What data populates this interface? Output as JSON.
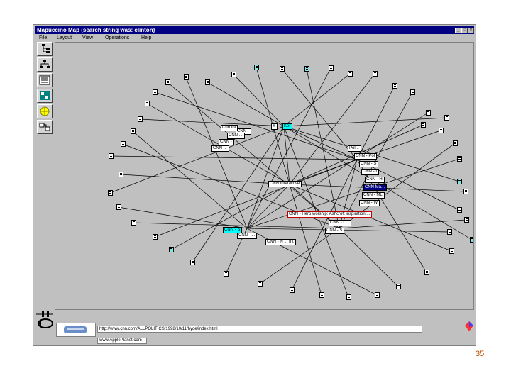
{
  "window": {
    "title": "Mapuccino Map (search string was: clinton)",
    "min": "_",
    "max": "□",
    "close": "×"
  },
  "menu": [
    {
      "label": "File"
    },
    {
      "label": "Layout"
    },
    {
      "label": "View"
    },
    {
      "label": "Operations"
    },
    {
      "label": "Help"
    }
  ],
  "toolbar_icons": [
    "tree-layout-icon",
    "hierarchy-layout-icon",
    "list-layout-icon",
    "map-layout-icon",
    "world-icon",
    "refresh-icon"
  ],
  "graph": {
    "labels": [
      {
        "text": "Y",
        "style": "white"
      },
      {
        "text": "Ker",
        "style": "hl"
      },
      {
        "text": "CNN -",
        "style": "white"
      },
      {
        "text": "CNN ...",
        "style": "white"
      },
      {
        "text": "CNN -",
        "style": "white"
      },
      {
        "text": "CNN ...",
        "style": "white"
      },
      {
        "text": "Cnn Int",
        "style": "white"
      },
      {
        "text": "CNN Interactive",
        "style": "white"
      },
      {
        "text": "Pol...",
        "style": "white"
      },
      {
        "text": "CNN - Pol",
        "style": "white"
      },
      {
        "text": "CNN - S",
        "style": "white"
      },
      {
        "text": "CNN - I",
        "style": "white"
      },
      {
        "text": "CNN - H",
        "style": "white"
      },
      {
        "text": "CNN Ma...",
        "style": "sel"
      },
      {
        "text": "CNN - ML",
        "style": "white"
      },
      {
        "text": "CNN - W",
        "style": "white"
      },
      {
        "text": "CNN - Hero worship: Ashcroft inspiration/...",
        "style": "red"
      },
      {
        "text": "CNN - L...",
        "style": "white"
      },
      {
        "text": "CNN - S",
        "style": "white"
      },
      {
        "text": "CNN - S",
        "style": "hl"
      },
      {
        "text": "CNN - ...",
        "style": "white"
      },
      {
        "text": "CNN - N ... Int",
        "style": "white"
      }
    ]
  },
  "status": {
    "url": "http://www.cnn.com/ALLPOLITICS/1998/10/11/hyde/index.html",
    "message": "www.ApplePlanet.com"
  },
  "slide": {
    "page_number": "35"
  }
}
